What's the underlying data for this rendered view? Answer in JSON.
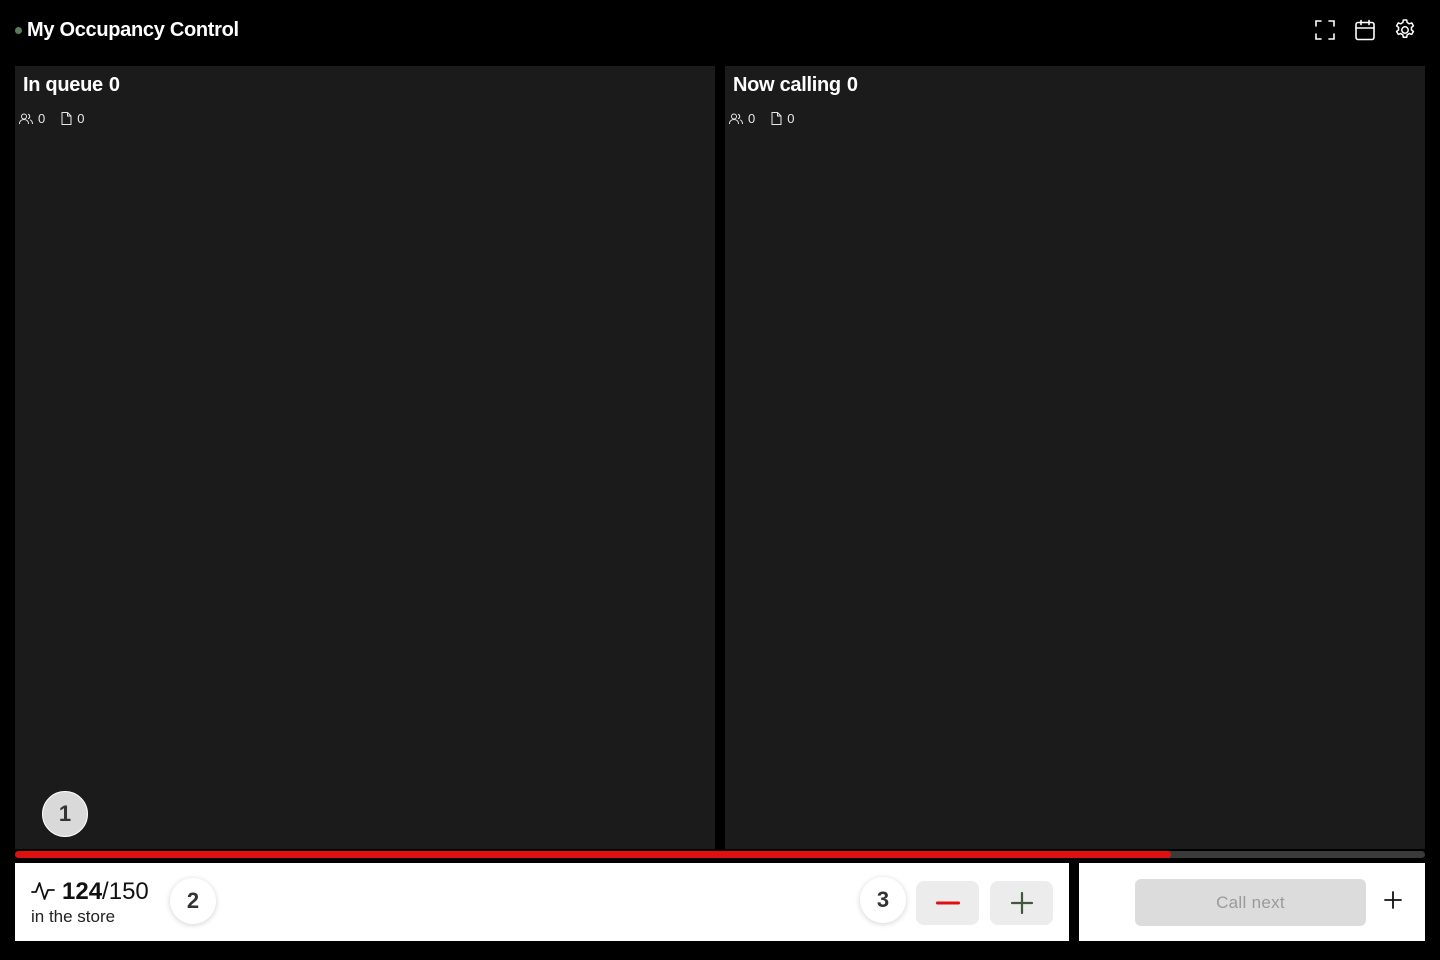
{
  "header": {
    "title": "My Occupancy Control",
    "status_color": "#5c7a5c",
    "icons": [
      "fullscreen-icon",
      "calendar-icon",
      "gear-icon"
    ]
  },
  "queue_panel": {
    "title_label": "In queue",
    "title_count": "0",
    "people_count": "0",
    "ticket_count": "0"
  },
  "calling_panel": {
    "title_label": "Now calling",
    "title_count": "0",
    "people_count": "0",
    "ticket_count": "0"
  },
  "occupancy": {
    "current": "124",
    "separator_max": "/150",
    "label": "in the store",
    "fill_fraction": 0.82,
    "bar_color": "#e01010"
  },
  "steps": {
    "step1": "1",
    "step2": "2",
    "step3": "3"
  },
  "actions": {
    "call_next_label": "Call next",
    "minus_color": "#e01010",
    "plus_color": "#3d5a3d"
  }
}
